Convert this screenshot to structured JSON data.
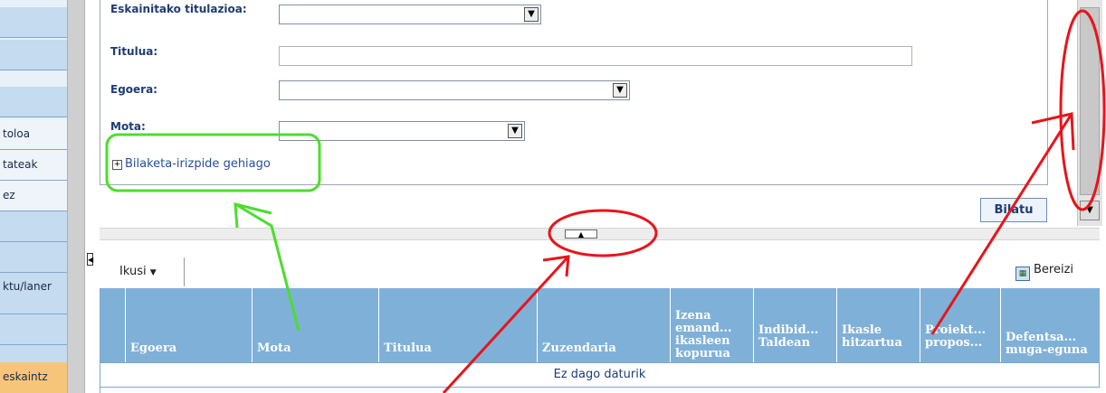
{
  "left_nav": {
    "items": [
      "toloa",
      "tateak",
      "ez",
      "",
      "",
      "ktu/laner",
      "",
      "eskaintz"
    ]
  },
  "form": {
    "fields": [
      {
        "label": "Eskainitako titulazioa:"
      },
      {
        "label": "Titulua:"
      },
      {
        "label": "Egoera:"
      },
      {
        "label": "Mota:"
      }
    ],
    "more_criteria": "Bilaketa-irizpide gehiago",
    "search_button": "Bilatu"
  },
  "toolbar": {
    "view": "Ikusi",
    "export": "Bereizi"
  },
  "grid": {
    "columns": [
      "Egoera",
      "Mota",
      "Titulua",
      "Zuzendaria",
      "Izena emand... ikasleen kopurua",
      "Indibid... Taldean",
      "Ikasle hitzartua",
      "Proiekt... propos...",
      "Defentsa... muga-eguna"
    ],
    "empty_message": "Ez dago daturik"
  },
  "colors": {
    "header_blue": "#7fb0d8",
    "annotation_green": "#4cdd2c",
    "annotation_red": "#e8141a"
  }
}
